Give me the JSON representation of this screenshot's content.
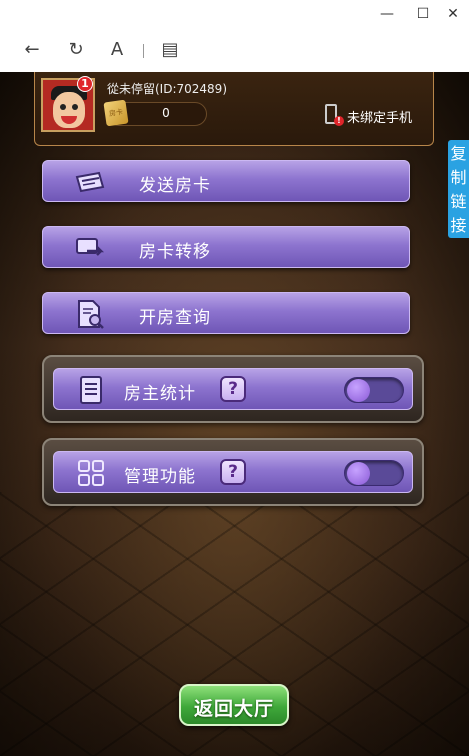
{
  "window": {
    "minimize": "—",
    "maximize": "☐",
    "close": "✕"
  },
  "toolbar": {
    "back": "←",
    "refresh": "↻",
    "font": "A",
    "reader": "▤"
  },
  "profile": {
    "username": "從未停留(ID:702489)",
    "badge_count": "1",
    "card_count": "0",
    "card_icon_text": "房卡",
    "phone_status": "未绑定手机"
  },
  "side_tab": {
    "label_chars": [
      "复",
      "制",
      "链",
      "接"
    ]
  },
  "menu": {
    "send_card": "发送房卡",
    "transfer_card": "房卡转移",
    "room_query": "开房查询"
  },
  "toggles": {
    "owner_stats": {
      "label": "房主统计",
      "help": "?"
    },
    "management": {
      "label": "管理功能",
      "help": "?"
    }
  },
  "footer": {
    "back_to_lobby": "返回大厅"
  },
  "colors": {
    "button_purple": "#8d74cf",
    "side_tab_blue": "#2aa2e2",
    "back_green": "#3fa83a",
    "badge_red": "#e0252a"
  },
  "icons": [
    "card-send-icon",
    "card-transfer-icon",
    "document-search-icon",
    "list-document-icon",
    "grid-apps-icon",
    "phone-icon"
  ]
}
